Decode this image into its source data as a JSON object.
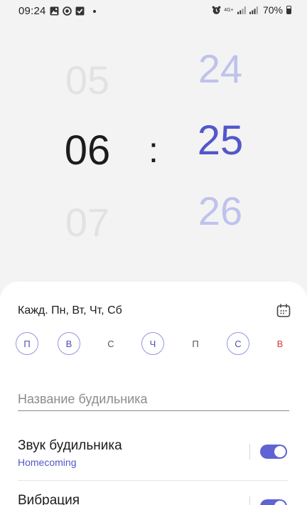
{
  "status_bar": {
    "time": "09:24",
    "battery": "70%",
    "network": "4G+",
    "left_icons": [
      "image-icon",
      "location-icon",
      "check-icon"
    ],
    "right_icons": [
      "alarm-icon",
      "signal-icon",
      "signal-icon",
      "battery-icon"
    ]
  },
  "picker": {
    "hour_prev": "05",
    "hour_current": "06",
    "hour_next": "07",
    "separator": ":",
    "minute_prev": "24",
    "minute_current": "25",
    "minute_next": "26"
  },
  "colors": {
    "accent": "#5257c9",
    "sunday": "#d04141"
  },
  "repeat": {
    "text": "Кажд. Пн, Вт, Чт, Сб"
  },
  "days": [
    {
      "label": "П",
      "selected": true
    },
    {
      "label": "В",
      "selected": true
    },
    {
      "label": "С",
      "selected": false
    },
    {
      "label": "Ч",
      "selected": true
    },
    {
      "label": "П",
      "selected": false
    },
    {
      "label": "С",
      "selected": true
    },
    {
      "label": "В",
      "selected": false
    }
  ],
  "alarm_name": {
    "value": "",
    "placeholder": "Название будильника"
  },
  "settings": {
    "sound_title": "Звук будильника",
    "sound_value": "Homecoming",
    "sound_enabled": true,
    "vibration_title": "Вибрация",
    "vibration_enabled": true
  }
}
